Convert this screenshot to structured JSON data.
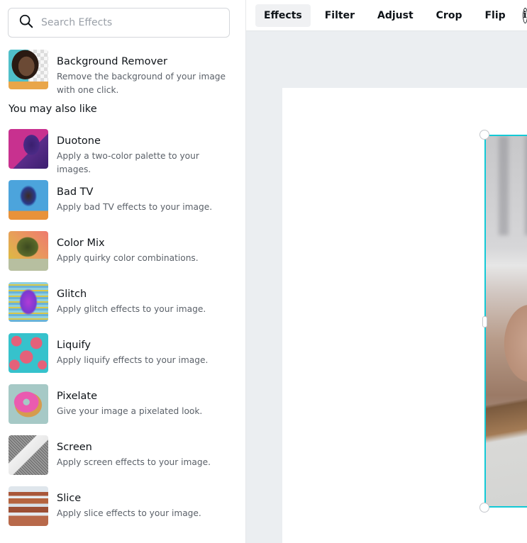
{
  "search": {
    "placeholder": "Search Effects",
    "value": ""
  },
  "featured": {
    "title": "Background Remover",
    "description_line1": "Remove the background of your image",
    "description_line2": "with one click."
  },
  "section_heading": "You may also like",
  "effects": [
    {
      "title": "Duotone",
      "description": "Apply a two-color palette to your images."
    },
    {
      "title": "Bad TV",
      "description": "Apply bad TV effects to your image."
    },
    {
      "title": "Color Mix",
      "description": "Apply quirky color combinations."
    },
    {
      "title": "Glitch",
      "description": "Apply glitch effects to your image."
    },
    {
      "title": "Liquify",
      "description": "Apply liquify effects to your image."
    },
    {
      "title": "Pixelate",
      "description": "Give your image a pixelated look."
    },
    {
      "title": "Screen",
      "description": "Apply screen effects to your image."
    },
    {
      "title": "Slice",
      "description": "Apply slice effects to your image."
    }
  ],
  "toolbar": {
    "tabs": [
      "Effects",
      "Filter",
      "Adjust",
      "Crop",
      "Flip"
    ],
    "active_tab": "Effects",
    "info_glyph": "i"
  },
  "colors": {
    "selection": "#13c9d6"
  }
}
